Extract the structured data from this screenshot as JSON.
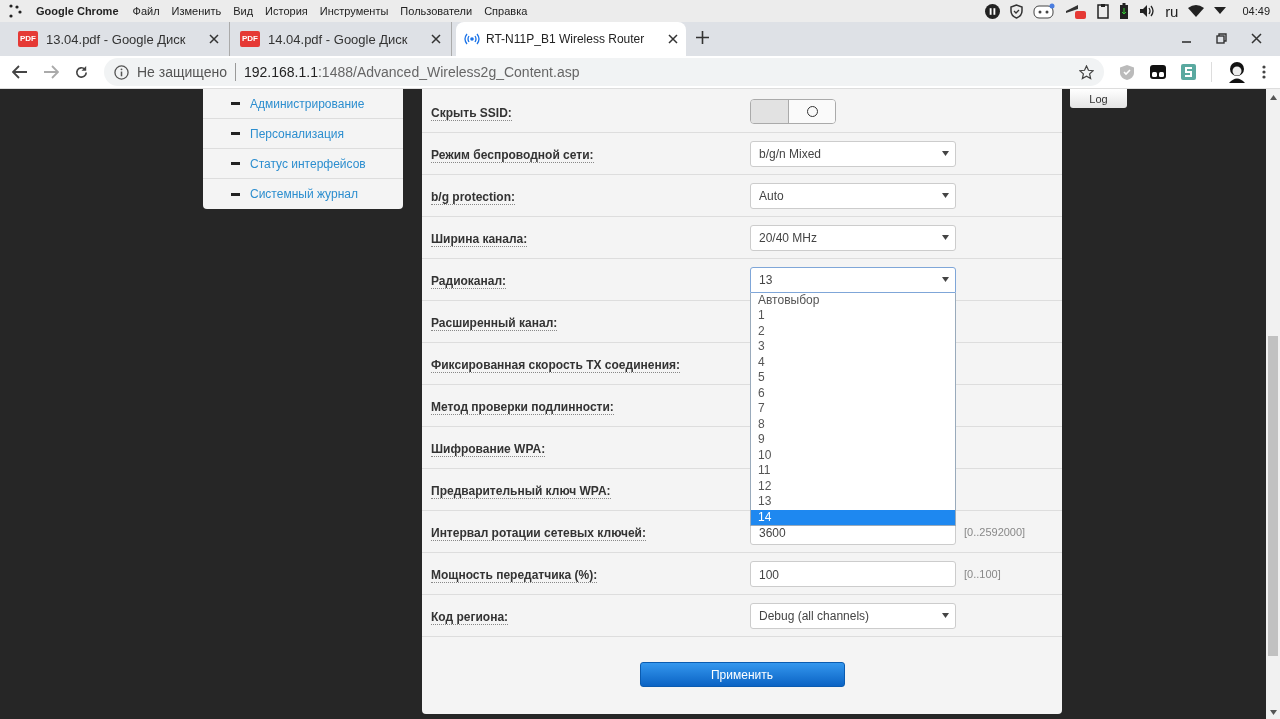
{
  "system_bar": {
    "app_name": "Google Chrome",
    "menu": [
      "Файл",
      "Изменить",
      "Вид",
      "История",
      "Инструменты",
      "Пользователи",
      "Справка"
    ],
    "language": "ru",
    "time": "04:49"
  },
  "tabs": [
    {
      "title": "13.04.pdf - Google Диск",
      "kind": "pdf",
      "badge": "PDF",
      "selected": false
    },
    {
      "title": "14.04.pdf - Google Диск",
      "kind": "pdf",
      "badge": "PDF",
      "selected": false
    },
    {
      "title": "RT-N11P_B1 Wireless Router",
      "kind": "router",
      "selected": true
    }
  ],
  "address_bar": {
    "security": "Не защищено",
    "host": "192.168.1.1",
    "path": ":1488/Advanced_Wireless2g_Content.asp"
  },
  "sidebar": {
    "items": [
      "Администрирование",
      "Персонализация",
      "Статус интерфейсов",
      "Системный журнал"
    ]
  },
  "log_button": "Log",
  "form": {
    "rows": [
      {
        "label": "Скрыть SSID:",
        "kind": "toggle",
        "on": false
      },
      {
        "label": "Режим беспроводной сети:",
        "kind": "select",
        "value": "b/g/n Mixed"
      },
      {
        "label": "b/g protection:",
        "kind": "select",
        "value": "Auto"
      },
      {
        "label": "Ширина канала:",
        "kind": "select",
        "value": "20/40 MHz"
      },
      {
        "label": "Радиоканал:",
        "kind": "select_open",
        "value": "13"
      },
      {
        "label": "Расширенный канал:",
        "kind": "hidden"
      },
      {
        "label": "Фиксированная скорость TX соединения:",
        "kind": "hidden"
      },
      {
        "label": "Метод проверки подлинности:",
        "kind": "hidden"
      },
      {
        "label": "Шифрование WPA:",
        "kind": "hidden"
      },
      {
        "label": "Предварительный ключ WPA:",
        "kind": "hidden"
      },
      {
        "label": "Интервал ротации сетевых ключей:",
        "kind": "input",
        "value": "3600",
        "hint": "[0..2592000]"
      },
      {
        "label": "Мощность передатчика (%):",
        "kind": "input",
        "value": "100",
        "hint": "[0..100]"
      },
      {
        "label": "Код региона:",
        "kind": "select",
        "value": "Debug (all channels)"
      }
    ],
    "dropdown_options": [
      {
        "label": "Автовыбор",
        "selected": false
      },
      {
        "label": "1",
        "selected": false
      },
      {
        "label": "2",
        "selected": false
      },
      {
        "label": "3",
        "selected": false
      },
      {
        "label": "4",
        "selected": false
      },
      {
        "label": "5",
        "selected": false
      },
      {
        "label": "6",
        "selected": false
      },
      {
        "label": "7",
        "selected": false
      },
      {
        "label": "8",
        "selected": false
      },
      {
        "label": "9",
        "selected": false
      },
      {
        "label": "10",
        "selected": false
      },
      {
        "label": "11",
        "selected": false
      },
      {
        "label": "12",
        "selected": false
      },
      {
        "label": "13",
        "selected": false
      },
      {
        "label": "14",
        "selected": true
      }
    ],
    "apply_button": "Применить"
  }
}
